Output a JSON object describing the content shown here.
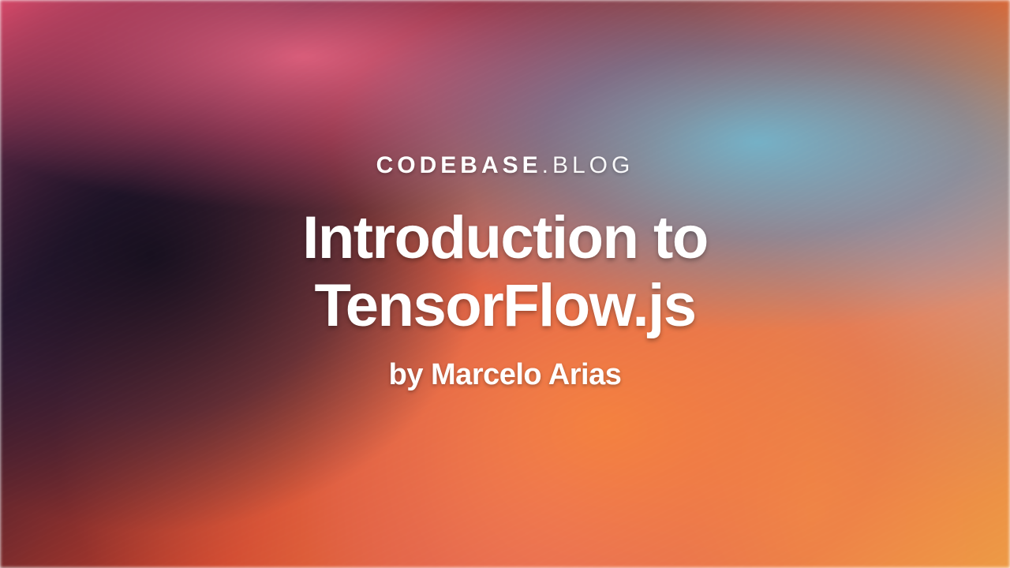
{
  "site": {
    "name_main": "CODEBASE",
    "name_sub": ".BLOG"
  },
  "article": {
    "title_line1": "Introduction to",
    "title_line2": "TensorFlow.js",
    "byline": "by Marcelo Arias"
  }
}
